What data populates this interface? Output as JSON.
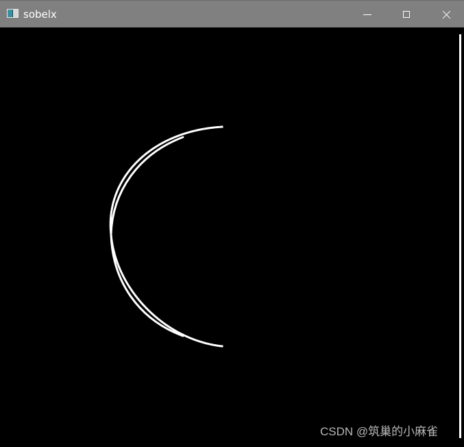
{
  "window": {
    "title": "sobelx",
    "titlebar_color": "#808080",
    "title_color": "#ffffff",
    "canvas_color": "#000000",
    "controls": {
      "minimize_icon": "minimize-icon",
      "maximize_icon": "maximize-icon",
      "close_icon": "close-icon"
    }
  },
  "image_view": {
    "edge_color": "#ffffff",
    "watermark": "CSDN @筑巢的小麻雀",
    "watermark_color": "#b7b7b7"
  }
}
